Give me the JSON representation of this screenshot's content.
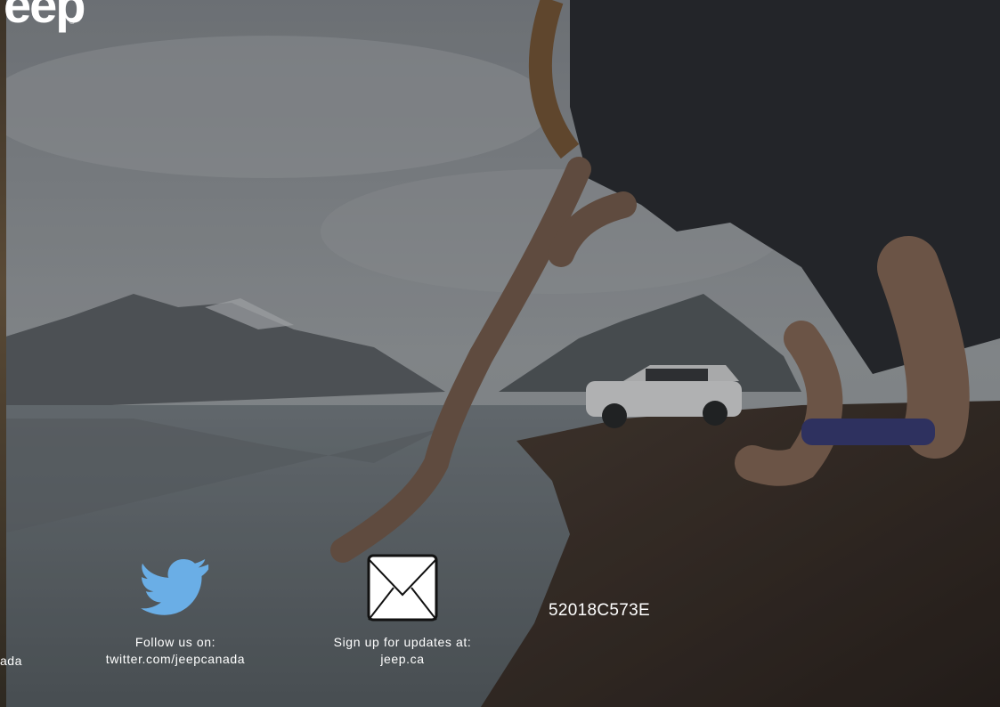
{
  "brand": {
    "logo_text": "eep",
    "reg_mark": "®"
  },
  "edge_text": "ada",
  "social": {
    "twitter": {
      "icon": "twitter-bird-icon",
      "line1": "Follow us on:",
      "line2": "twitter.com/jeepcanada",
      "color": "#6aaee6"
    },
    "email": {
      "icon": "envelope-icon",
      "line1": "Sign up for updates at:",
      "line2": "jeep.ca"
    }
  },
  "code": "52018C573E"
}
